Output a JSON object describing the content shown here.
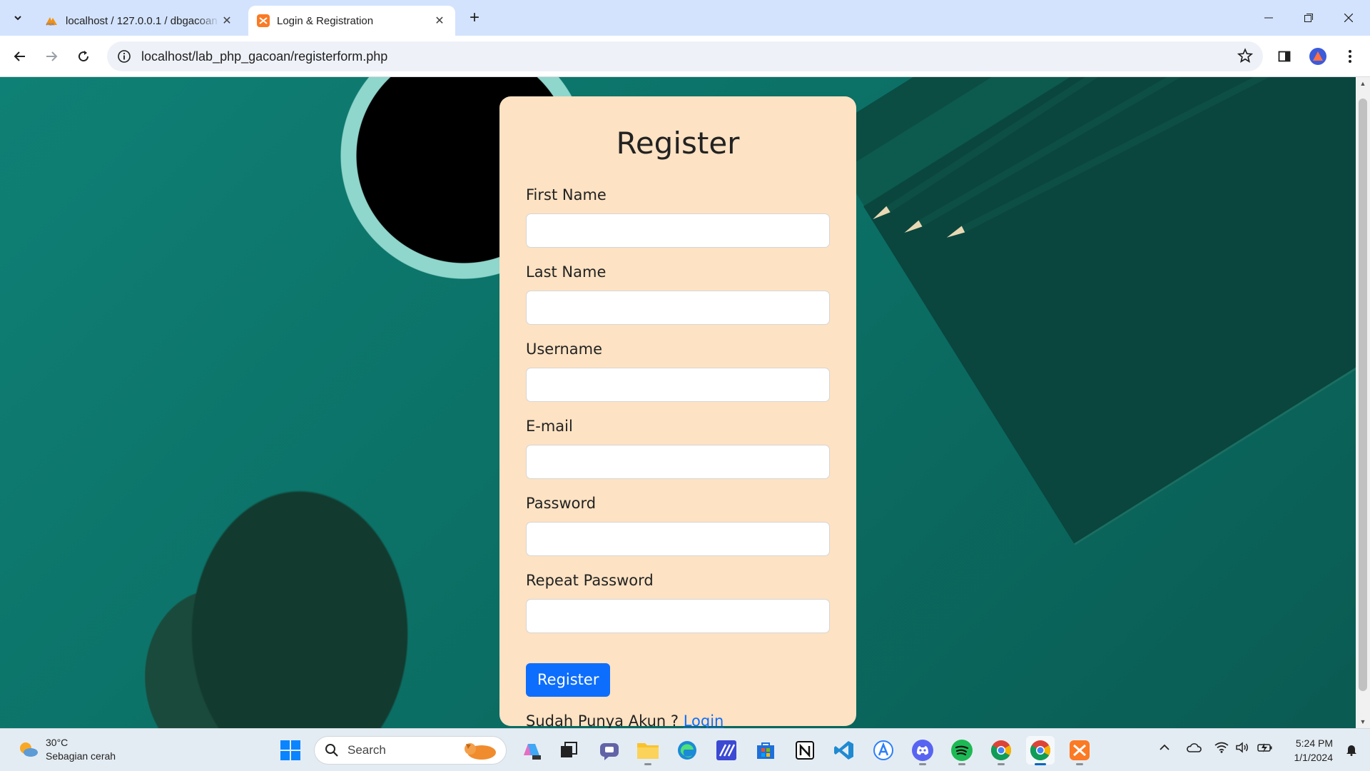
{
  "browser": {
    "tabs": [
      {
        "title": "localhost / 127.0.0.1 / dbgacoan",
        "active": false
      },
      {
        "title": "Login & Registration",
        "active": true
      }
    ],
    "address": "localhost/lab_php_gacoan/registerform.php"
  },
  "form": {
    "title": "Register",
    "fields": [
      {
        "label": "First Name"
      },
      {
        "label": "Last Name"
      },
      {
        "label": "Username"
      },
      {
        "label": "E-mail"
      },
      {
        "label": "Password"
      },
      {
        "label": "Repeat Password"
      }
    ],
    "submit_label": "Register",
    "login_prompt": "Sudah Punya Akun ?",
    "login_link": "Login",
    "accent_color": "#0d6efd",
    "card_color": "#fde2c3"
  },
  "taskbar": {
    "weather_temp": "30°C",
    "weather_desc": "Sebagian cerah",
    "search_placeholder": "Search",
    "time": "5:24 PM",
    "date": "1/1/2024"
  }
}
